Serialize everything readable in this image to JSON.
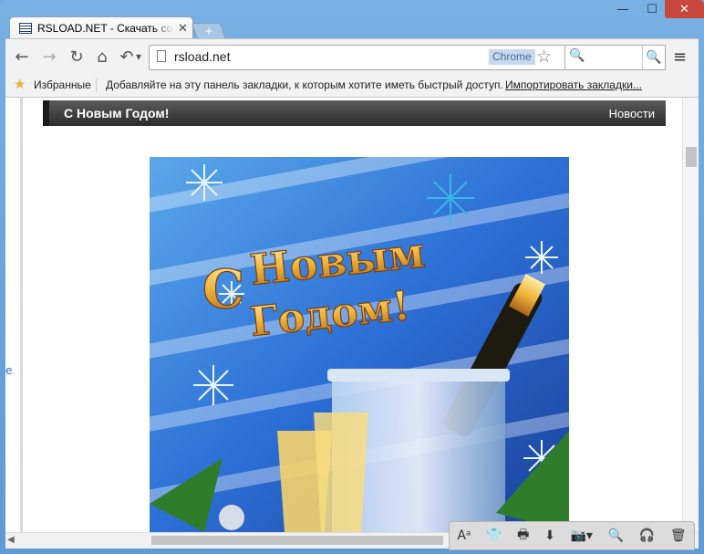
{
  "window": {
    "controls": {
      "minimize": "—",
      "maximize": "☐",
      "close": "✕"
    }
  },
  "tab": {
    "title": "RSLOAD.NET - Скачать софт",
    "close": "✕",
    "newtab": "+"
  },
  "toolbar": {
    "back": "←",
    "forward": "→",
    "reload": "↻",
    "home": "⌂",
    "undo": "↶",
    "undo_menu": "▾",
    "url": "rsload.net",
    "badge": "Chrome",
    "star": "☆",
    "search_icon": "🔍",
    "search_button": "🔍",
    "menu": "≡"
  },
  "bookmarks": {
    "star": "★",
    "favorites": "Избранные",
    "hint": "Добавляйте на эту панель закладки, к которым хотите иметь быстрый доступ.",
    "import": "Импортировать закладки..."
  },
  "page": {
    "stray_char": "e",
    "news_title": "С Новым Годом!",
    "news_category": "Новости",
    "card_text": [
      "С",
      "Новым",
      "Годом!"
    ]
  },
  "extbar": {
    "icons": [
      "font-size-icon",
      "shirt-icon",
      "print-icon",
      "download-icon",
      "camera-icon",
      "search-icon",
      "headphones-icon",
      "trash-icon"
    ],
    "glyphs": [
      "Aᵃ",
      "👕",
      "🖶",
      "⬇",
      "📷▾",
      "🔍",
      "🎧",
      "🗑"
    ]
  },
  "colors": {
    "titlebar": "#78b0e4",
    "close_button": "#c9483e",
    "news_bar": "#3b3b3b",
    "card_blue": "#2f6fd8",
    "card_gold": "#f0b43a"
  }
}
